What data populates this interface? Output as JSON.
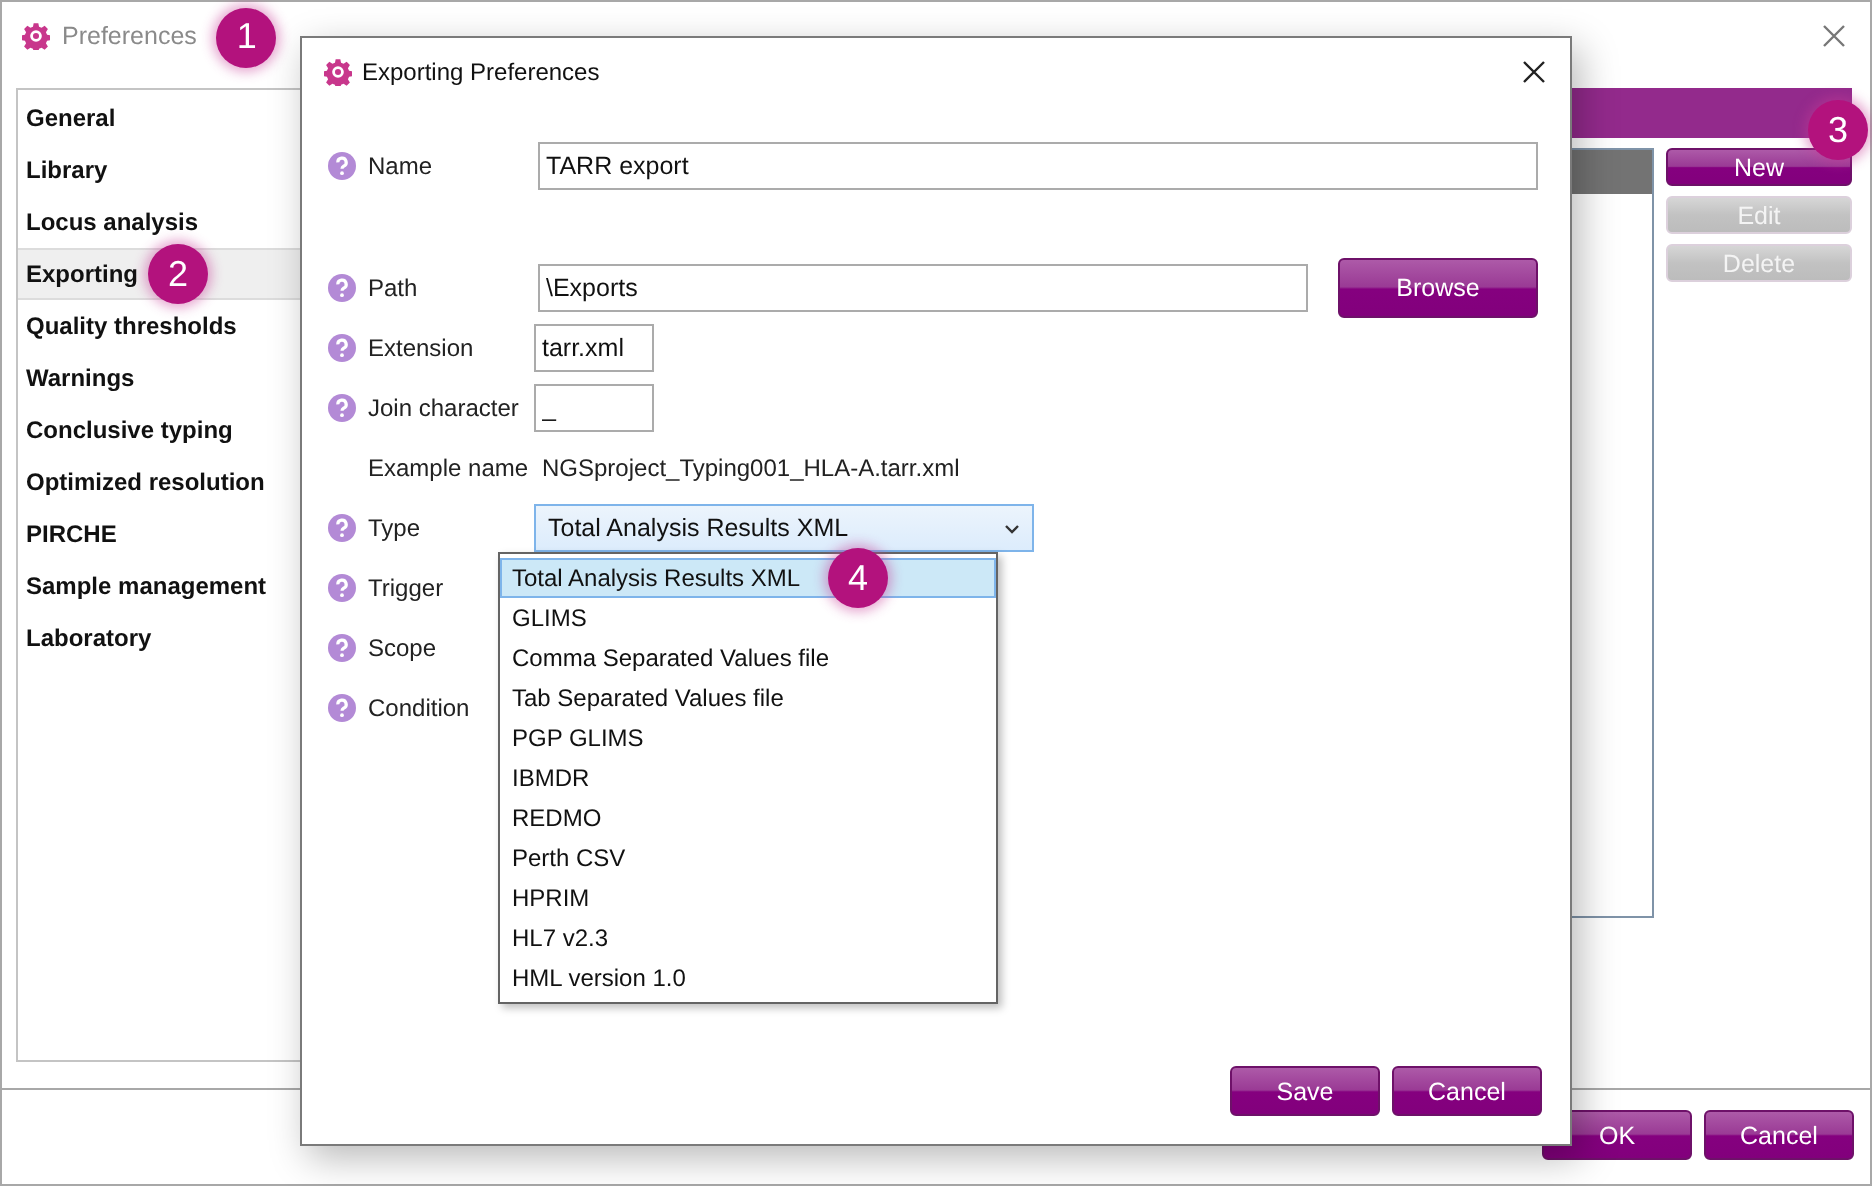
{
  "window": {
    "title": "Preferences",
    "callout": "1"
  },
  "sidebar": {
    "items": [
      {
        "label": "General",
        "selected": false
      },
      {
        "label": "Library",
        "selected": false
      },
      {
        "label": "Locus analysis",
        "selected": false
      },
      {
        "label": "Exporting",
        "selected": true,
        "callout": "2"
      },
      {
        "label": "Quality thresholds",
        "selected": false
      },
      {
        "label": "Warnings",
        "selected": false
      },
      {
        "label": "Conclusive typing",
        "selected": false
      },
      {
        "label": "Optimized resolution",
        "selected": false
      },
      {
        "label": "PIRCHE",
        "selected": false
      },
      {
        "label": "Sample management",
        "selected": false
      },
      {
        "label": "Laboratory",
        "selected": false
      }
    ]
  },
  "list_buttons": [
    {
      "label": "New",
      "disabled": false,
      "callout": "3"
    },
    {
      "label": "Edit",
      "disabled": true
    },
    {
      "label": "Delete",
      "disabled": true
    }
  ],
  "footer_buttons": [
    "OK",
    "Cancel"
  ],
  "dialog": {
    "title": "Exporting Preferences",
    "fields": [
      {
        "kind": "wide",
        "label": "Name",
        "value": "TARR export"
      },
      {
        "kind": "path",
        "label": "Path",
        "value": "\\Exports",
        "button": "Browse"
      },
      {
        "kind": "short",
        "label": "Extension",
        "value": "tarr.xml"
      },
      {
        "kind": "short",
        "label": "Join character",
        "value": "_"
      },
      {
        "kind": "info",
        "label": "Example name",
        "value": "NGSproject_Typing001_HLA-A.tarr.xml"
      },
      {
        "kind": "select",
        "label": "Type",
        "value": "Total Analysis Results XML",
        "expanded": true,
        "options": [
          {
            "label": "Total Analysis Results XML",
            "selected": true,
            "callout": "4"
          },
          {
            "label": "GLIMS",
            "selected": false
          },
          {
            "label": "Comma Separated Values file",
            "selected": false
          },
          {
            "label": "Tab Separated Values file",
            "selected": false
          },
          {
            "label": "PGP GLIMS",
            "selected": false
          },
          {
            "label": "IBMDR",
            "selected": false
          },
          {
            "label": "REDMO",
            "selected": false
          },
          {
            "label": "Perth CSV",
            "selected": false
          },
          {
            "label": "HPRIM",
            "selected": false
          },
          {
            "label": "HL7 v2.3",
            "selected": false
          },
          {
            "label": "HML version 1.0",
            "selected": false
          }
        ]
      },
      {
        "kind": "covered",
        "label": "Trigger"
      },
      {
        "kind": "covered",
        "label": "Scope"
      },
      {
        "kind": "covered",
        "label": "Condition"
      }
    ],
    "buttons": [
      "Save",
      "Cancel"
    ]
  }
}
